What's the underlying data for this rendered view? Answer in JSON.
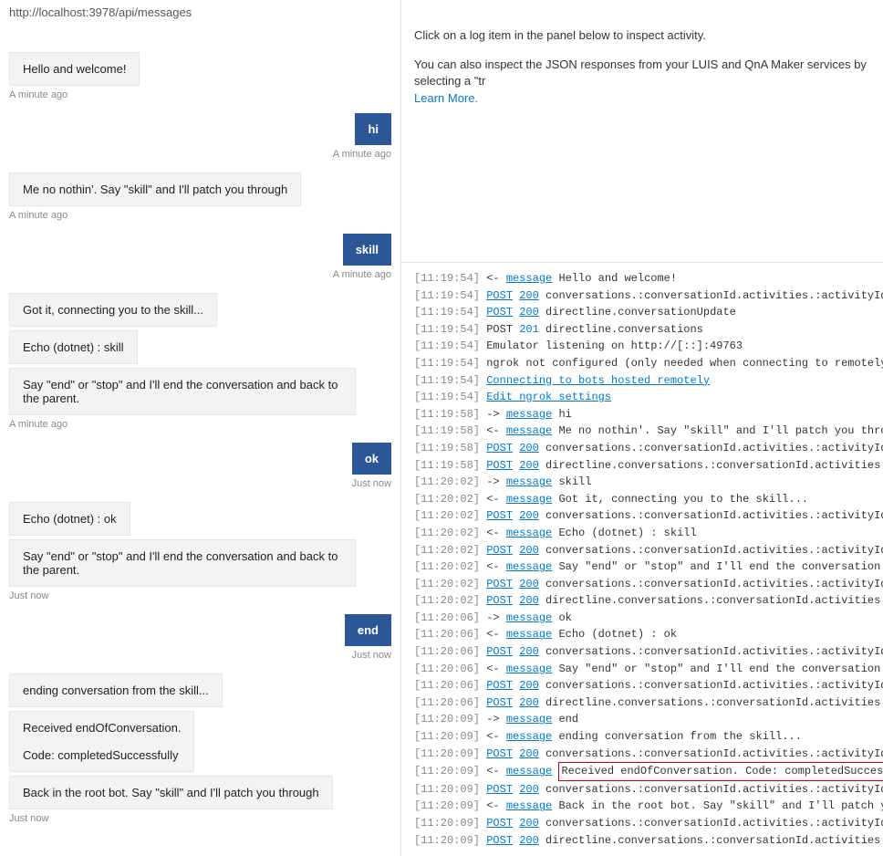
{
  "url": "http://localhost:3978/api/messages",
  "chat": [
    {
      "side": "bot",
      "lines": [
        "Hello and welcome!"
      ],
      "ts": "A minute ago"
    },
    {
      "side": "user",
      "text": "hi",
      "ts": "A minute ago"
    },
    {
      "side": "bot",
      "lines": [
        "Me no nothin'. Say \"skill\" and I'll patch you through"
      ],
      "ts": "A minute ago"
    },
    {
      "side": "user",
      "text": "skill",
      "ts": "A minute ago"
    },
    {
      "side": "bot",
      "lines": [
        "Got it, connecting you to the skill...",
        "Echo (dotnet) : skill",
        "Say \"end\" or \"stop\" and I'll end the conversation and back to the parent."
      ],
      "ts": "A minute ago"
    },
    {
      "side": "user",
      "text": "ok",
      "ts": "Just now"
    },
    {
      "side": "bot",
      "lines": [
        "Echo (dotnet) : ok",
        "Say \"end\" or \"stop\" and I'll end the conversation and back to the parent."
      ],
      "ts": "Just now"
    },
    {
      "side": "user",
      "text": "end",
      "ts": "Just now"
    },
    {
      "side": "bot",
      "lines": [
        "ending conversation from the skill...",
        "Received endOfConversation.\n\nCode: completedSuccessfully",
        "Back in the root bot. Say \"skill\" and I'll patch you through"
      ],
      "ts": "Just now"
    }
  ],
  "right": {
    "p1": "Click on a log item in the panel below to inspect activity.",
    "p2": "You can also inspect the JSON responses from your LUIS and QnA Maker services by selecting a \"tr",
    "learn_more": "Learn More."
  },
  "log": [
    {
      "ts": "[11:19:54]",
      "dir": "<-",
      "type": "message",
      "typeLink": true,
      "code": "",
      "text": "Hello and welcome!"
    },
    {
      "ts": "[11:19:54]",
      "dir": "",
      "type": "POST",
      "typeLink": true,
      "code": "200",
      "text": "conversations.:conversationId.activities.:activityId"
    },
    {
      "ts": "[11:19:54]",
      "dir": "",
      "type": "POST",
      "typeLink": true,
      "code": "200",
      "text": "directline.conversationUpdate"
    },
    {
      "ts": "[11:19:54]",
      "dir": "",
      "type": "POST",
      "typeLink": false,
      "code": "201",
      "text": "directline.conversations"
    },
    {
      "ts": "[11:19:54]",
      "dir": "",
      "type": "",
      "typeLink": false,
      "code": "",
      "text": "Emulator listening on http://[::]:49763"
    },
    {
      "ts": "[11:19:54]",
      "dir": "",
      "type": "",
      "typeLink": false,
      "code": "",
      "text": "ngrok not configured (only needed when connecting to remotely hosted"
    },
    {
      "ts": "[11:19:54]",
      "dir": "",
      "type": "",
      "typeLink": false,
      "code": "",
      "text": "",
      "onlyLink": "Connecting to bots hosted remotely"
    },
    {
      "ts": "[11:19:54]",
      "dir": "",
      "type": "",
      "typeLink": false,
      "code": "",
      "text": "",
      "onlyLink": "Edit ngrok settings"
    },
    {
      "ts": "[11:19:58]",
      "dir": "->",
      "type": "message",
      "typeLink": true,
      "code": "",
      "text": "hi"
    },
    {
      "ts": "[11:19:58]",
      "dir": "<-",
      "type": "message",
      "typeLink": true,
      "code": "",
      "text": "Me no nothin'. Say \"skill\" and I'll patch you thro..."
    },
    {
      "ts": "[11:19:58]",
      "dir": "",
      "type": "POST",
      "typeLink": true,
      "code": "200",
      "text": "conversations.:conversationId.activities.:activityId"
    },
    {
      "ts": "[11:19:58]",
      "dir": "",
      "type": "POST",
      "typeLink": true,
      "code": "200",
      "text": "directline.conversations.:conversationId.activities"
    },
    {
      "ts": "[11:20:02]",
      "dir": "->",
      "type": "message",
      "typeLink": true,
      "code": "",
      "text": "skill"
    },
    {
      "ts": "[11:20:02]",
      "dir": "<-",
      "type": "message",
      "typeLink": true,
      "code": "",
      "text": "Got it, connecting you to the skill..."
    },
    {
      "ts": "[11:20:02]",
      "dir": "",
      "type": "POST",
      "typeLink": true,
      "code": "200",
      "text": "conversations.:conversationId.activities.:activityId"
    },
    {
      "ts": "[11:20:02]",
      "dir": "<-",
      "type": "message",
      "typeLink": true,
      "code": "",
      "text": "Echo (dotnet) : skill"
    },
    {
      "ts": "[11:20:02]",
      "dir": "",
      "type": "POST",
      "typeLink": true,
      "code": "200",
      "text": "conversations.:conversationId.activities.:activityId"
    },
    {
      "ts": "[11:20:02]",
      "dir": "<-",
      "type": "message",
      "typeLink": true,
      "code": "",
      "text": "Say \"end\" or \"stop\" and I'll end the conversation ..."
    },
    {
      "ts": "[11:20:02]",
      "dir": "",
      "type": "POST",
      "typeLink": true,
      "code": "200",
      "text": "conversations.:conversationId.activities.:activityId"
    },
    {
      "ts": "[11:20:02]",
      "dir": "",
      "type": "POST",
      "typeLink": true,
      "code": "200",
      "text": "directline.conversations.:conversationId.activities"
    },
    {
      "ts": "[11:20:06]",
      "dir": "->",
      "type": "message",
      "typeLink": true,
      "code": "",
      "text": "ok"
    },
    {
      "ts": "[11:20:06]",
      "dir": "<-",
      "type": "message",
      "typeLink": true,
      "code": "",
      "text": "Echo (dotnet) : ok"
    },
    {
      "ts": "[11:20:06]",
      "dir": "",
      "type": "POST",
      "typeLink": true,
      "code": "200",
      "text": "conversations.:conversationId.activities.:activityId"
    },
    {
      "ts": "[11:20:06]",
      "dir": "<-",
      "type": "message",
      "typeLink": true,
      "code": "",
      "text": "Say \"end\" or \"stop\" and I'll end the conversation ..."
    },
    {
      "ts": "[11:20:06]",
      "dir": "",
      "type": "POST",
      "typeLink": true,
      "code": "200",
      "text": "conversations.:conversationId.activities.:activityId"
    },
    {
      "ts": "[11:20:06]",
      "dir": "",
      "type": "POST",
      "typeLink": true,
      "code": "200",
      "text": "directline.conversations.:conversationId.activities"
    },
    {
      "ts": "[11:20:09]",
      "dir": "->",
      "type": "message",
      "typeLink": true,
      "code": "",
      "text": "end"
    },
    {
      "ts": "[11:20:09]",
      "dir": "<-",
      "type": "message",
      "typeLink": true,
      "code": "",
      "text": "ending conversation from the skill..."
    },
    {
      "ts": "[11:20:09]",
      "dir": "",
      "type": "POST",
      "typeLink": true,
      "code": "200",
      "text": "conversations.:conversationId.activities.:activityId"
    },
    {
      "ts": "[11:20:09]",
      "dir": "<-",
      "type": "message",
      "typeLink": true,
      "code": "",
      "text": "Received endOfConversation. Code: completedSucces...",
      "highlight": true
    },
    {
      "ts": "[11:20:09]",
      "dir": "",
      "type": "POST",
      "typeLink": true,
      "code": "200",
      "text": "conversations.:conversationId.activities.:activityId"
    },
    {
      "ts": "[11:20:09]",
      "dir": "<-",
      "type": "message",
      "typeLink": true,
      "code": "",
      "text": "Back in the root bot. Say \"skill\" and I'll patch y..."
    },
    {
      "ts": "[11:20:09]",
      "dir": "",
      "type": "POST",
      "typeLink": true,
      "code": "200",
      "text": "conversations.:conversationId.activities.:activityId"
    },
    {
      "ts": "[11:20:09]",
      "dir": "",
      "type": "POST",
      "typeLink": true,
      "code": "200",
      "text": "directline.conversations.:conversationId.activities"
    }
  ]
}
